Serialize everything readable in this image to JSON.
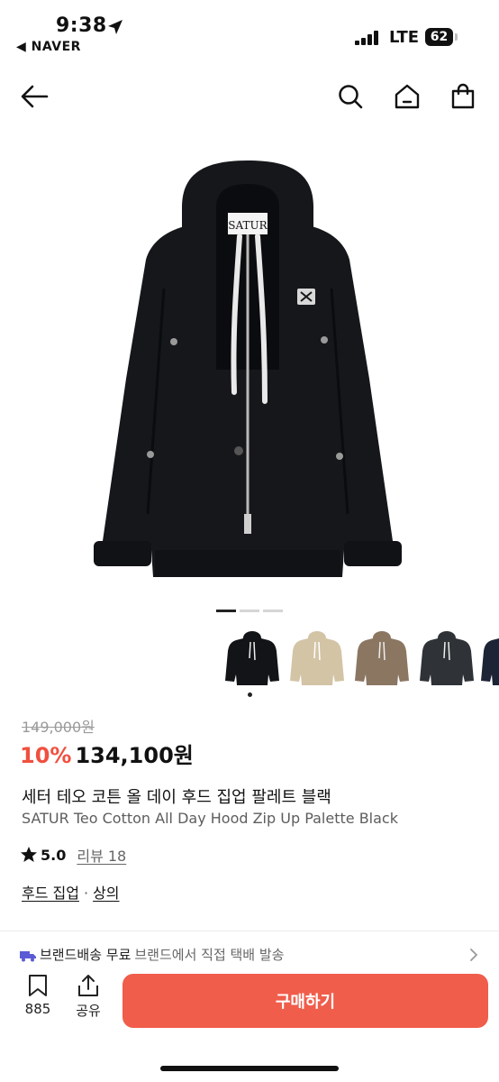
{
  "status_bar": {
    "time": "9:38",
    "back_app": "◀ NAVER",
    "network": "LTE",
    "battery": "62"
  },
  "nav": {
    "back_icon": "arrow-left-icon",
    "search_icon": "search-icon",
    "home_icon": "home-icon",
    "cart_icon": "shopping-bag-icon"
  },
  "gallery": {
    "total_images": 3,
    "current_index": 0
  },
  "color_options": [
    {
      "color": "#121418"
    },
    {
      "color": "#d3c4a6"
    },
    {
      "color": "#8b7662"
    },
    {
      "color": "#2f3236"
    },
    {
      "color": "#1c2436"
    }
  ],
  "product": {
    "original_price": "149,000원",
    "discount": "10%",
    "price": "134,100원",
    "title_ko": "세터 테오 코튼 올 데이 후드 집업 팔레트 블랙",
    "title_en": "SATUR Teo Cotton All Day Hood Zip Up Palette Black",
    "rating": "5.0",
    "review_label": "리뷰 18",
    "categories": [
      "후드 집업",
      "상의"
    ],
    "category_separator": "·"
  },
  "shipping": {
    "title": "브랜드배송 무료",
    "desc": "브랜드에서 직접 택배 발송"
  },
  "bottom_bar": {
    "bookmark_count": "885",
    "share_label": "공유",
    "buy_label": "구매하기"
  },
  "colors": {
    "accent": "#f05d4b",
    "discount": "#f0503f",
    "shipping_icon": "#5b5bd6"
  }
}
